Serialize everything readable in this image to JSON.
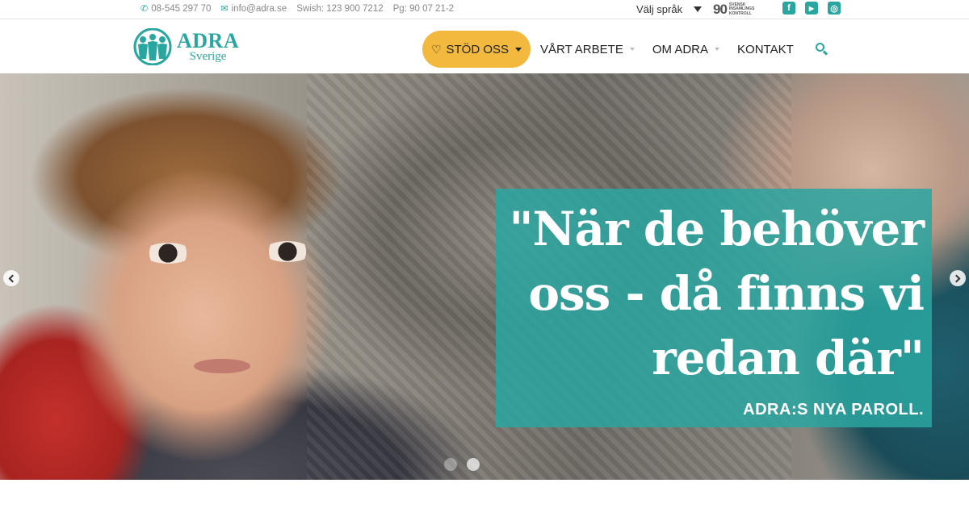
{
  "topbar": {
    "phone": "08-545 297 70",
    "email": "info@adra.se",
    "swish": "Swish: 123 900 7212",
    "pg": "Pg: 90 07 21-2",
    "language_label": "Välj språk",
    "badge_number": "90",
    "badge_lines": [
      "SVENSK",
      "INSAMLINGS",
      "KONTROLL"
    ],
    "social": [
      {
        "icon": "facebook-icon",
        "glyph": "f"
      },
      {
        "icon": "youtube-icon",
        "glyph": "▶"
      },
      {
        "icon": "instagram-icon",
        "glyph": "◎"
      }
    ]
  },
  "header": {
    "logo_title": "ADRA",
    "logo_subtitle": "Sverige",
    "nav": {
      "support_label": "STÖD OSS",
      "work_label": "VÅRT ARBETE",
      "about_label": "OM ADRA",
      "contact_label": "KONTAKT"
    }
  },
  "hero": {
    "quote": "\"När de behöver oss - då finns vi redan där\"",
    "caption": "ADRA:S NYA PAROLL.",
    "slide_count": 2,
    "active_slide": 2
  },
  "colors": {
    "accent": "#2aa6a0",
    "button": "#f3b93f"
  }
}
